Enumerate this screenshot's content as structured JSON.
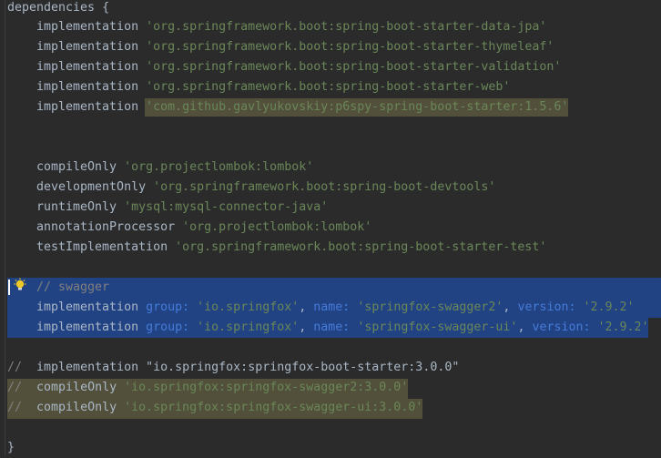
{
  "code": {
    "dependencies_open": "dependencies {",
    "impl_kw": "implementation",
    "impl1_str": "'org.springframework.boot:spring-boot-starter-data-jpa'",
    "impl2_str": "'org.springframework.boot:spring-boot-starter-thymeleaf'",
    "impl3_str": "'org.springframework.boot:spring-boot-starter-validation'",
    "impl4_str": "'org.springframework.boot:spring-boot-starter-web'",
    "impl5_str": "'com.github.gavlyukovskiy:p6spy-spring-boot-starter:1.5.6'",
    "compileOnly_kw": "compileOnly",
    "compileOnly_str": "'org.projectlombok:lombok'",
    "developmentOnly_kw": "developmentOnly",
    "developmentOnly_str": "'org.springframework.boot:spring-boot-devtools'",
    "runtimeOnly_kw": "runtimeOnly",
    "runtimeOnly_str": "'mysql:mysql-connector-java'",
    "annotationProcessor_kw": "annotationProcessor",
    "annotationProcessor_str": "'org.projectlombok:lombok'",
    "testImplementation_kw": "testImplementation",
    "testImplementation_str": "'org.springframework.boot:spring-boot-starter-test'",
    "swagger_comment": "// swagger",
    "group_label": "group:",
    "name_label": "name:",
    "version_label": "version:",
    "springfox_group": "'io.springfox'",
    "swagger2_name": "'springfox-swagger2'",
    "swaggerui_name": "'springfox-swagger-ui'",
    "version_val": "'2.9.2'",
    "comma": ",",
    "c1_slashes": "//",
    "c1_text": "implementation \"io.springfox:springfox-boot-starter:3.0.0\"",
    "c2_slashes": "//",
    "c2_kw": "compileOnly",
    "c2_str": "'io.springfox:springfox-swagger2:3.0.0'",
    "c3_slashes": "//",
    "c3_kw": "compileOnly",
    "c3_str": "'io.springfox:springfox-swagger-ui:3.0.0'",
    "closing_brace": "}"
  },
  "colors": {
    "background": "#2b2b2b",
    "selection": "#214283",
    "warning_highlight": "#52503a",
    "string": "#6a8759",
    "named_arg": "#467cda",
    "comment": "#808080",
    "text": "#a9b7c6"
  },
  "icons": [
    "lightbulb-icon"
  ]
}
